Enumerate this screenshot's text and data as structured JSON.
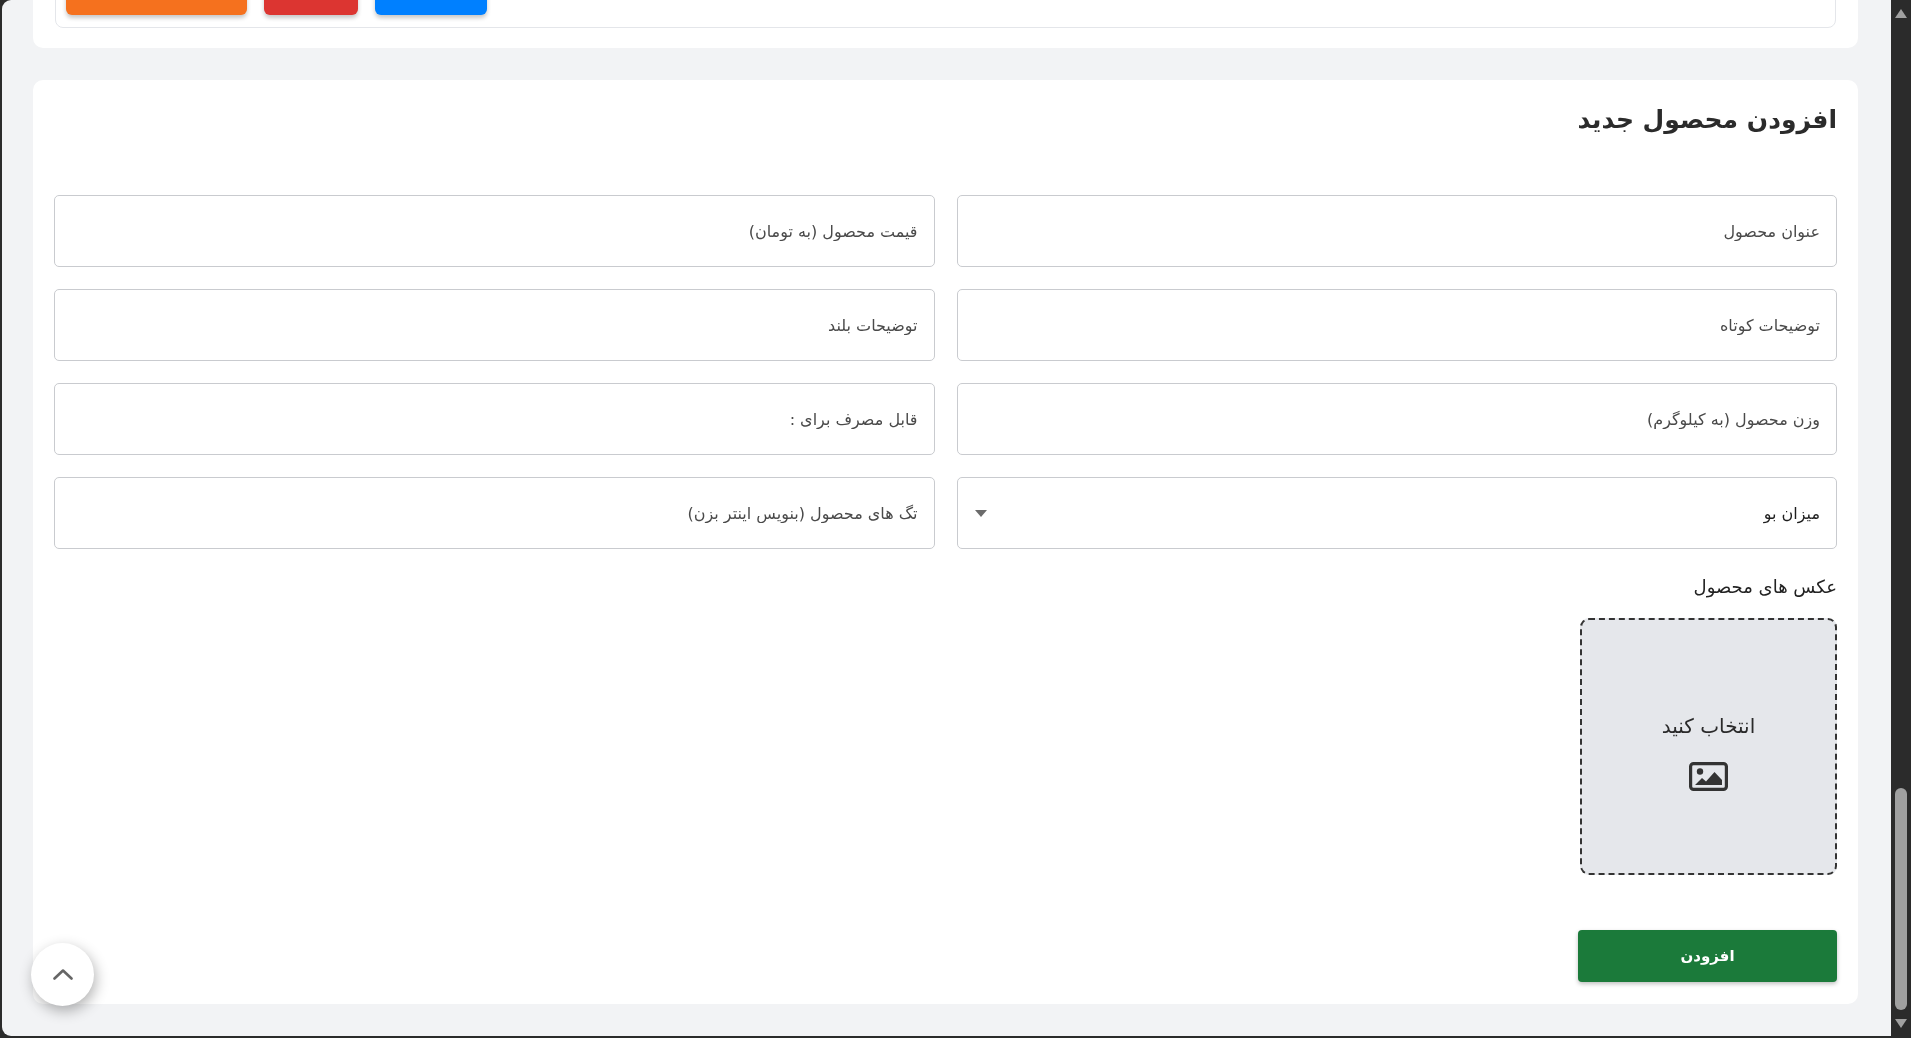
{
  "top_buttons": [
    {
      "color": "#f5711e"
    },
    {
      "color": "#dc3531"
    },
    {
      "color": "#0080ff"
    }
  ],
  "form": {
    "title": "افزودن محصول جدید",
    "fields": [
      {
        "kind": "text",
        "placeholder": "عنوان محصول"
      },
      {
        "kind": "text",
        "placeholder": "قیمت محصول (به تومان)"
      },
      {
        "kind": "text",
        "placeholder": "توضیحات کوتاه"
      },
      {
        "kind": "text",
        "placeholder": "توضیحات بلند"
      },
      {
        "kind": "text",
        "placeholder": "وزن محصول (به کیلوگرم)"
      },
      {
        "kind": "text",
        "placeholder": "قابل مصرف برای :"
      },
      {
        "kind": "select",
        "value": "میزان بو"
      },
      {
        "kind": "text",
        "placeholder": "تگ های محصول (بنویس اینتر بزن)"
      }
    ],
    "images": {
      "label": "عکس های محصول",
      "upload_text": "انتخاب کنید"
    },
    "submit": "افزودن"
  }
}
